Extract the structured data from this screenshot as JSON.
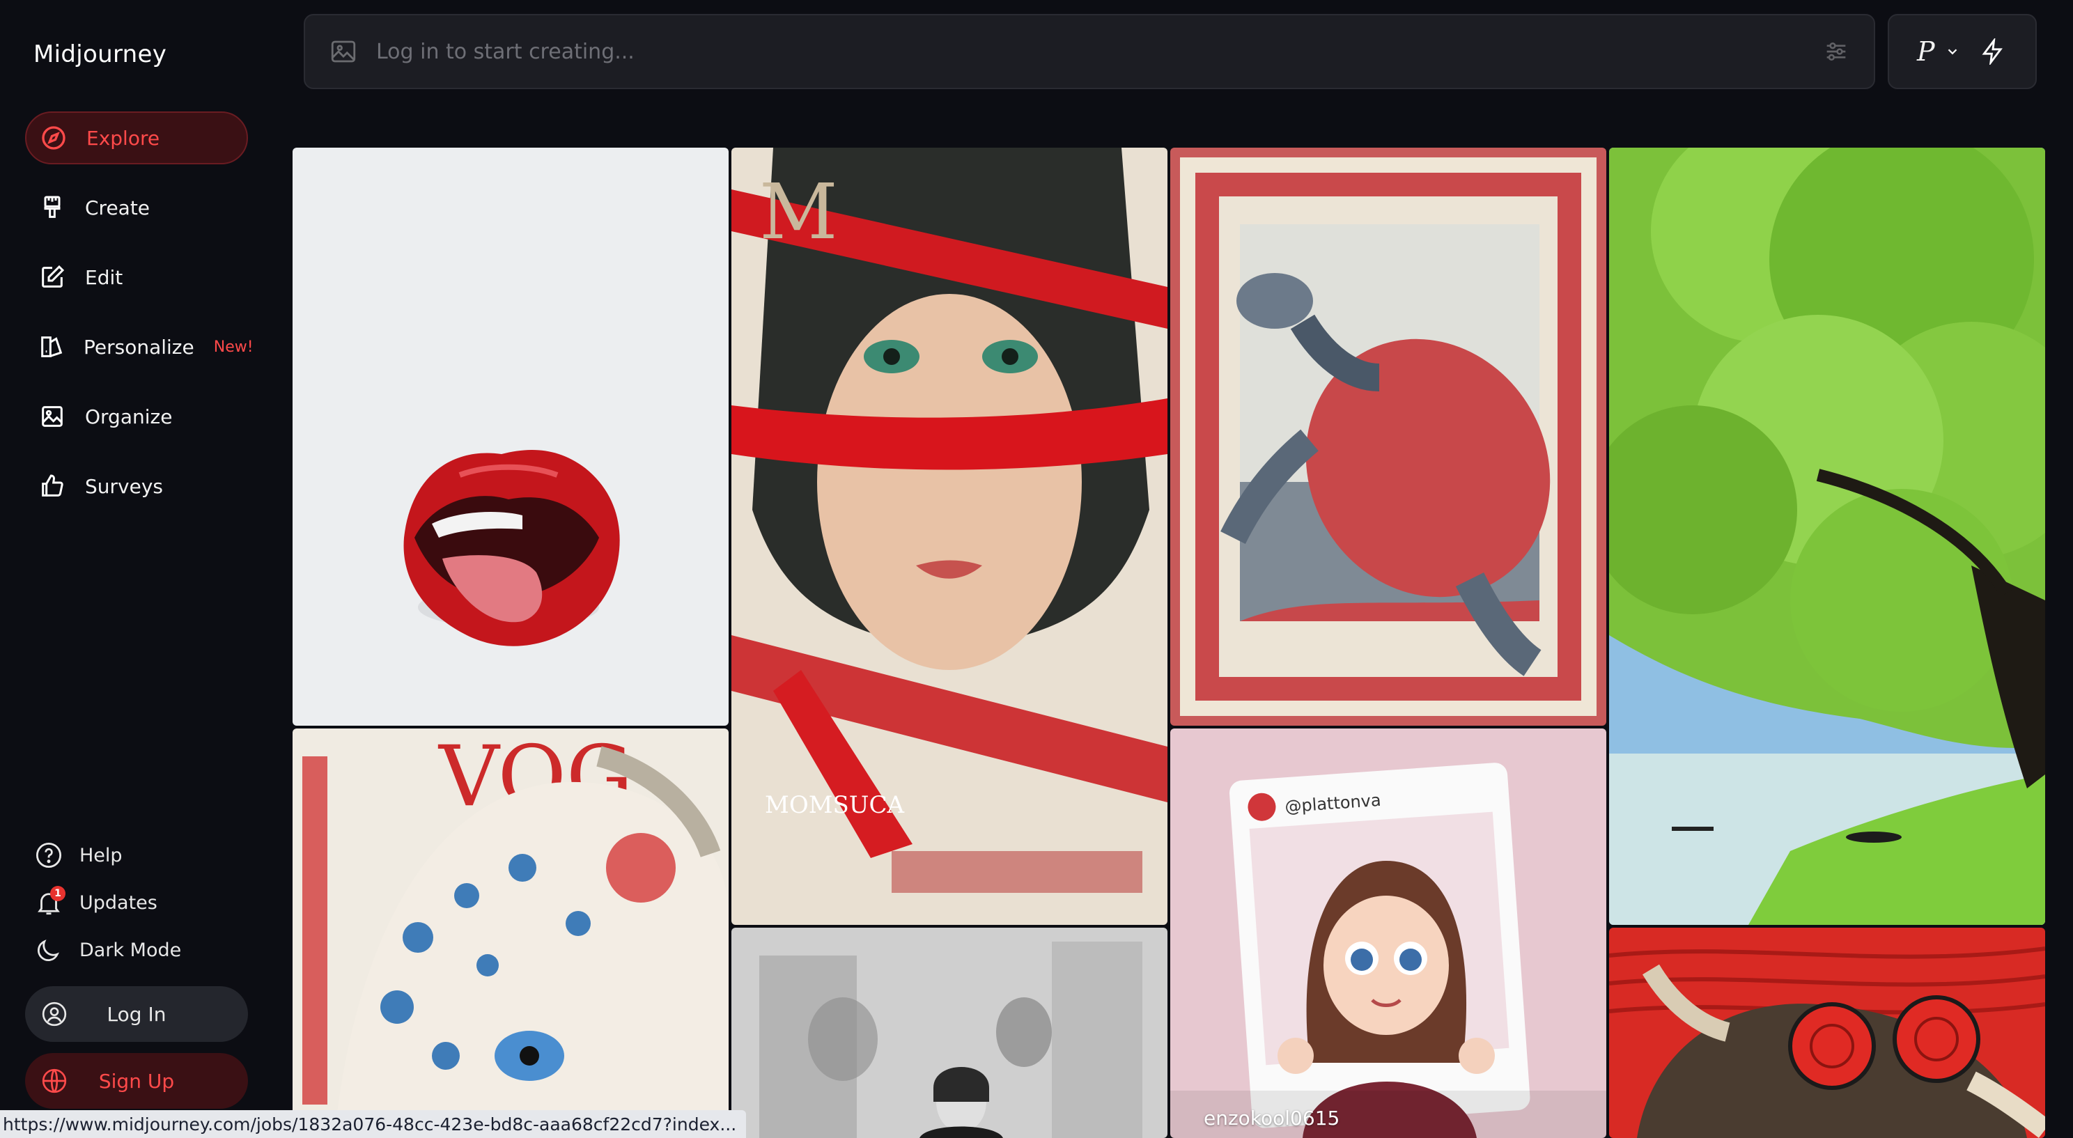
{
  "app": {
    "brand": "Midjourney"
  },
  "nav": {
    "items": [
      {
        "label": "Explore",
        "icon": "compass-icon",
        "active": true
      },
      {
        "label": "Create",
        "icon": "paintbrush-icon"
      },
      {
        "label": "Edit",
        "icon": "edit-icon"
      },
      {
        "label": "Personalize",
        "icon": "personalize-icon",
        "badge": "New!"
      },
      {
        "label": "Organize",
        "icon": "image-icon"
      },
      {
        "label": "Surveys",
        "icon": "thumbs-up-icon"
      }
    ]
  },
  "utility": {
    "help": "Help",
    "updates": "Updates",
    "updates_count": "1",
    "dark_mode": "Dark Mode"
  },
  "auth": {
    "login": "Log In",
    "signup": "Sign Up"
  },
  "search": {
    "placeholder": "Log in to start creating..."
  },
  "mode": {
    "label": "P"
  },
  "gallery": {
    "tiles": [
      {
        "subject": "red-lips-tongue"
      },
      {
        "subject": "girl-red-ribbon-poster",
        "poster_title": "MOMSUCA",
        "poster_letter": "M"
      },
      {
        "subject": "turtle-postage-stamp"
      },
      {
        "subject": "green-tree-lake"
      },
      {
        "subject": "leopard-vogue-cover",
        "cover_text": "VOG"
      },
      {
        "subject": "blurred-crowd-bw"
      },
      {
        "subject": "cartoon-girl-frame",
        "handle": "@plattonva",
        "user": "enzokool0615"
      },
      {
        "subject": "bull-red-glasses"
      }
    ]
  },
  "status": {
    "url": "https://www.midjourney.com/jobs/1832a076-48cc-423e-bd8c-aaa68cf22cd7?index..."
  },
  "colors": {
    "accent": "#ff4a4a",
    "bg": "#0c0d13",
    "panel": "#1c1d23"
  }
}
